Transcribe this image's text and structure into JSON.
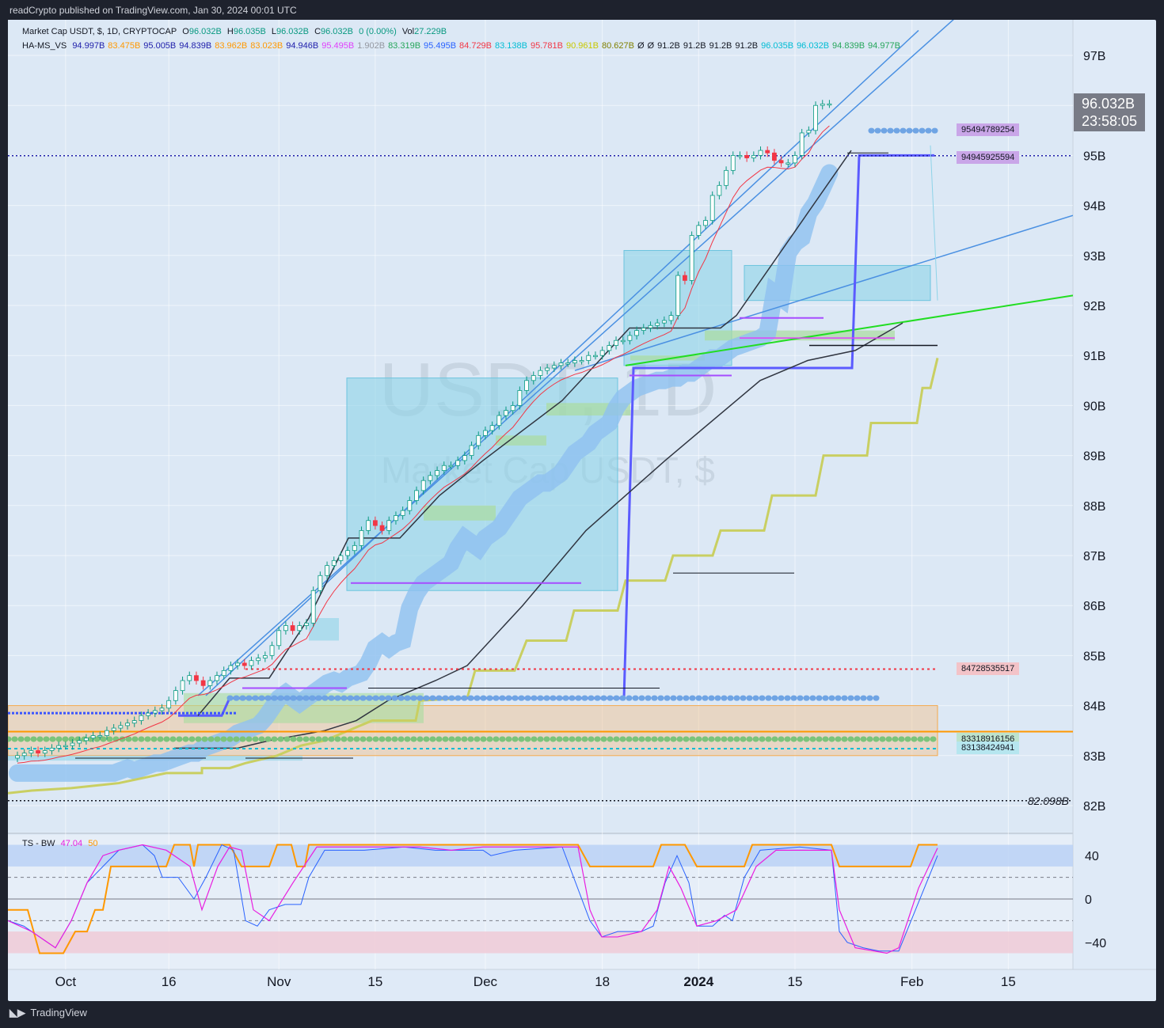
{
  "header": {
    "published": "readCrypto published on TradingView.com, Jan 30, 2024 00:01 UTC"
  },
  "legend_main": {
    "symbol": "Market Cap USDT, $, 1D, CRYPTOCAP",
    "o_label": "O",
    "o": "96.032B",
    "h_label": "H",
    "h": "96.035B",
    "l_label": "L",
    "l": "96.032B",
    "c_label": "C",
    "c": "96.032B",
    "change": "0 (0.00%)",
    "vol_label": "Vol",
    "vol": "27.229B"
  },
  "legend_indicator": {
    "name": "HA-MS_VS",
    "values": [
      {
        "v": "94.997B",
        "color": "#1e1eaa"
      },
      {
        "v": "83.475B",
        "color": "#ff9800"
      },
      {
        "v": "95.005B",
        "color": "#1e1eaa"
      },
      {
        "v": "94.839B",
        "color": "#1e1eaa"
      },
      {
        "v": "83.962B",
        "color": "#ff9800"
      },
      {
        "v": "83.023B",
        "color": "#ff9800"
      },
      {
        "v": "94.946B",
        "color": "#1e1eaa"
      },
      {
        "v": "95.495B",
        "color": "#e040fb"
      },
      {
        "v": "1.902B",
        "color": "#9598a1"
      },
      {
        "v": "83.319B",
        "color": "#26a65b"
      },
      {
        "v": "95.495B",
        "color": "#2962ff"
      },
      {
        "v": "84.729B",
        "color": "#f23645"
      },
      {
        "v": "83.138B",
        "color": "#00bcd4"
      },
      {
        "v": "95.781B",
        "color": "#f23645"
      },
      {
        "v": "90.961B",
        "color": "#c8c800"
      },
      {
        "v": "80.627B",
        "color": "#808000"
      },
      {
        "v": "Ø",
        "color": "#131722"
      },
      {
        "v": "Ø",
        "color": "#131722"
      },
      {
        "v": "91.2B",
        "color": "#131722"
      },
      {
        "v": "91.2B",
        "color": "#131722"
      },
      {
        "v": "91.2B",
        "color": "#131722"
      },
      {
        "v": "91.2B",
        "color": "#131722"
      },
      {
        "v": "96.035B",
        "color": "#00bcd4"
      },
      {
        "v": "96.032B",
        "color": "#00bcd4"
      },
      {
        "v": "94.839B",
        "color": "#26a65b"
      },
      {
        "v": "94.977B",
        "color": "#26a65b"
      }
    ]
  },
  "legend_osc": {
    "name": "TS - BW",
    "v1": "47.04",
    "v1_color": "#e91ee0",
    "v2": "50",
    "v2_color": "#ff9800"
  },
  "watermark": {
    "symbol": "USDT, 1D",
    "name": "Market Cap USDT, $"
  },
  "price_tag": {
    "value": "96.032B",
    "countdown": "23:58:05"
  },
  "side_labels": [
    {
      "text": "95494789254",
      "value": 95.495,
      "bg": "#c9a6e8"
    },
    {
      "text": "94945925594",
      "value": 94.946,
      "bg": "#c9a6e8"
    },
    {
      "text": "84728535517",
      "value": 84.729,
      "bg": "#f3c3c8"
    },
    {
      "text": "83318916156",
      "value": 83.319,
      "bg": "#bde3cd"
    },
    {
      "text": "83138424941",
      "value": 83.138,
      "bg": "#b6e6ef"
    }
  ],
  "low_line_label": "82.098B",
  "axis": {
    "y_ticks": [
      "97B",
      "96B",
      "95B",
      "94B",
      "93B",
      "92B",
      "91B",
      "90B",
      "89B",
      "88B",
      "87B",
      "86B",
      "85B",
      "84B",
      "83B",
      "82B"
    ],
    "y_values": [
      97,
      96,
      95,
      94,
      93,
      92,
      91,
      90,
      89,
      88,
      87,
      86,
      85,
      84,
      83,
      82
    ],
    "osc_ticks": [
      "40",
      "0",
      "−40"
    ],
    "x_ticks": [
      {
        "label": "Oct",
        "idx": 7,
        "bold": false
      },
      {
        "label": "16",
        "idx": 22,
        "bold": false
      },
      {
        "label": "Nov",
        "idx": 38,
        "bold": false
      },
      {
        "label": "15",
        "idx": 52,
        "bold": false
      },
      {
        "label": "Dec",
        "idx": 68,
        "bold": false
      },
      {
        "label": "18",
        "idx": 85,
        "bold": false
      },
      {
        "label": "2024",
        "idx": 99,
        "bold": true
      },
      {
        "label": "15",
        "idx": 113,
        "bold": false
      },
      {
        "label": "Feb",
        "idx": 130,
        "bold": false
      },
      {
        "label": "15",
        "idx": 144,
        "bold": false
      }
    ]
  },
  "footer": {
    "brand": "TradingView"
  },
  "chart_data": {
    "type": "line",
    "title": "Market Cap USDT, $, 1D, CRYPTOCAP",
    "ylim": [
      81.5,
      97.8
    ],
    "x_first": "2023-09-24",
    "x_last": "2024-01-30",
    "close": [
      83.0,
      83.05,
      83.1,
      83.05,
      83.1,
      83.15,
      83.2,
      83.2,
      83.25,
      83.3,
      83.35,
      83.4,
      83.4,
      83.5,
      83.55,
      83.6,
      83.65,
      83.7,
      83.8,
      83.85,
      83.9,
      83.95,
      84.1,
      84.3,
      84.5,
      84.6,
      84.5,
      84.4,
      84.5,
      84.6,
      84.7,
      84.8,
      84.85,
      84.8,
      84.9,
      84.95,
      85.0,
      85.2,
      85.5,
      85.6,
      85.5,
      85.6,
      85.65,
      86.3,
      86.6,
      86.8,
      86.9,
      87.0,
      87.1,
      87.2,
      87.5,
      87.7,
      87.6,
      87.5,
      87.7,
      87.8,
      87.9,
      88.1,
      88.3,
      88.5,
      88.6,
      88.7,
      88.8,
      88.8,
      88.9,
      89.0,
      89.2,
      89.4,
      89.5,
      89.6,
      89.8,
      89.9,
      90.0,
      90.3,
      90.5,
      90.6,
      90.7,
      90.75,
      90.8,
      90.85,
      90.85,
      90.9,
      90.9,
      91.0,
      91.0,
      91.1,
      91.2,
      91.3,
      91.3,
      91.4,
      91.5,
      91.55,
      91.6,
      91.65,
      91.7,
      91.8,
      92.6,
      92.5,
      93.4,
      93.6,
      93.7,
      94.2,
      94.4,
      94.7,
      95.0,
      95.0,
      94.95,
      95.0,
      95.1,
      95.05,
      94.9,
      94.85,
      94.85,
      95.0,
      95.45,
      95.5,
      96.0,
      96.03,
      96.03
    ]
  }
}
